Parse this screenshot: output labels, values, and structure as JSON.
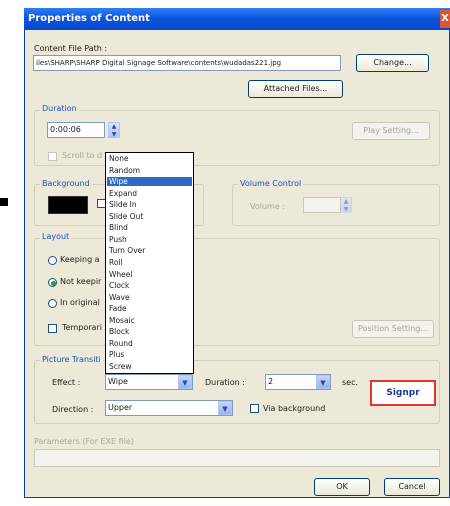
{
  "window": {
    "title": "Properties of Content",
    "close_glyph": "X"
  },
  "content_file_path": {
    "label": "Content File Path :",
    "value": "iles\\SHARP\\SHARP Digital Signage Software\\contents\\wudadas221.jpg",
    "change_button": "Change...",
    "attached_files_button": "Attached Files..."
  },
  "duration": {
    "group_label": "Duration",
    "value": "0:00:06",
    "play_setting_button": "Play Setting...",
    "scroll_label": "Scroll to d"
  },
  "background": {
    "group_label": "Background",
    "swatch_color": "#000000"
  },
  "volume": {
    "group_label": "Volume Control",
    "label": "Volume :"
  },
  "layout": {
    "group_label": "Layout",
    "options": [
      "Keeping a",
      "Not keepir",
      "In original"
    ],
    "selected_index": 1,
    "temporary_label": "Temporari",
    "position_setting_button": "Position Setting..."
  },
  "picture_transition": {
    "group_label": "Picture Transiti",
    "effect_label": "Effect :",
    "effect_value": "Wipe",
    "duration_label": "Duration :",
    "duration_value": "2",
    "sec_label": "sec.",
    "direction_label": "Direction :",
    "direction_value": "Upper",
    "via_background_label": "Via background"
  },
  "effect_dropdown": {
    "items": [
      "None",
      "Random",
      "Wipe",
      "Expand",
      "Slide In",
      "Slide Out",
      "Blind",
      "Push",
      "Turn Over",
      "Roll",
      "Wheel",
      "Clock",
      "Wave",
      "Fade",
      "Mosaic",
      "Block",
      "Round",
      "Plus",
      "Screw"
    ],
    "selected_index": 2
  },
  "parameters": {
    "label": "Parameters (For EXE file)"
  },
  "footer": {
    "ok_button": "OK",
    "cancel_button": "Cancel"
  },
  "signature": {
    "text": "Signpr"
  },
  "colors": {
    "title_bar": "#0c56e0",
    "dialog_bg": "#ece9d8",
    "selection": "#316ac5",
    "group_label": "#1a4fc4"
  }
}
